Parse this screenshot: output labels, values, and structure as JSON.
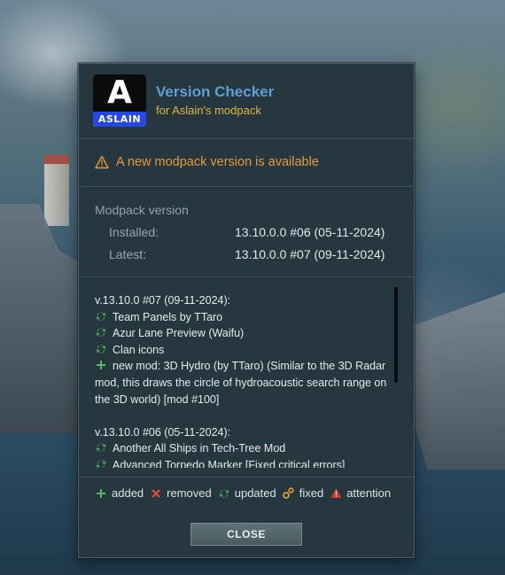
{
  "header": {
    "logo_letter": "A",
    "logo_text": "ASLAIN",
    "title": "Version Checker",
    "subtitle": "for Aslain's modpack"
  },
  "alert": {
    "icon": "warning-triangle-icon",
    "text": "A new modpack version is available",
    "color": "#e69a3a"
  },
  "modpack": {
    "section_label": "Modpack version",
    "installed_label": "Installed:",
    "installed_value": "13.10.0.0 #06 (05-11-2024)",
    "latest_label": "Latest:",
    "latest_value": "13.10.0.0 #07 (09-11-2024)"
  },
  "changelog": {
    "block1_header": "v.13.10.0 #07 (09-11-2024):",
    "block1_items": [
      {
        "icon": "updated-icon",
        "text": "Team Panels by TTaro"
      },
      {
        "icon": "updated-icon",
        "text": "Azur Lane Preview (Waifu)"
      },
      {
        "icon": "updated-icon",
        "text": "Clan icons"
      },
      {
        "icon": "added-icon",
        "text": "new mod: 3D Hydro (by TTaro) (Similar to the 3D Radar"
      }
    ],
    "block1_cont_1": "mod, this draws the circle of hydroacoustic search range on",
    "block1_cont_2": "the 3D world) [mod #100]",
    "block2_header": "v.13.10.0 #06 (05-11-2024):",
    "block2_items": [
      {
        "icon": "updated-icon",
        "text": "Another All Ships in Tech-Tree Mod"
      },
      {
        "icon": "updated-icon",
        "text": "Advanced Torpedo Marker [Fixed critical errors]"
      }
    ]
  },
  "legend": {
    "added": "added",
    "removed": "removed",
    "updated": "updated",
    "fixed": "fixed",
    "attention": "attention"
  },
  "close_label": "CLOSE",
  "colors": {
    "added": "#4fbf5a",
    "removed": "#e0502c",
    "updated": "#4fbf5a",
    "fixed": "#e0a02c",
    "attention": "#d83a2a",
    "title": "#5f9ed6",
    "subtitle": "#e0b53a"
  }
}
